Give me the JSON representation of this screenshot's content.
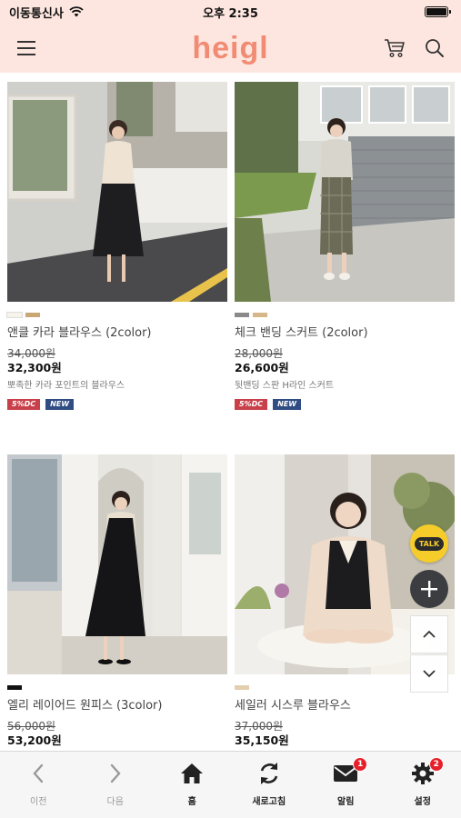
{
  "status_bar": {
    "carrier": "이동통신사",
    "time": "오후 2:35",
    "battery_level": 1.0
  },
  "header": {
    "logo": "heigl"
  },
  "products": [
    {
      "name": "앤클 카라 블라우스 (2color)",
      "original_price": "34,000원",
      "price": "32,300원",
      "description": "뽀족한 카라 포인트의 블라우스",
      "swatches": [
        "#f7f3ea",
        "#c8a774"
      ],
      "badges": [
        "5%DC",
        "NEW"
      ]
    },
    {
      "name": "체크 밴딩 스커트 (2color)",
      "original_price": "28,000원",
      "price": "26,600원",
      "description": "뒷밴딩 스판 H라인 스커트",
      "swatches": [
        "#8a8a8a",
        "#d6b78a"
      ],
      "badges": [
        "5%DC",
        "NEW"
      ]
    },
    {
      "name": "엘리 레이어드 원피스 (3color)",
      "original_price": "56,000원",
      "price": "53,200원",
      "swatches": [
        "#111111"
      ]
    },
    {
      "name": "세일러 시스루 블라우스",
      "original_price": "37,000원",
      "price": "35,150원",
      "swatches": [
        "#e3cfae"
      ]
    }
  ],
  "floating": {
    "talk_label": "TALK"
  },
  "bottom_nav": [
    {
      "label": "이전",
      "icon": "chevron-left-icon"
    },
    {
      "label": "다음",
      "icon": "chevron-right-icon"
    },
    {
      "label": "홈",
      "icon": "home-icon"
    },
    {
      "label": "새로고침",
      "icon": "refresh-icon"
    },
    {
      "label": "알림",
      "icon": "mail-icon",
      "badge": "1"
    },
    {
      "label": "설정",
      "icon": "gear-icon",
      "badge": "2"
    }
  ],
  "colors": {
    "header_bg": "#fde6df",
    "logo": "#f28b73",
    "discount_badge": "#c9404b",
    "new_badge": "#2f4c83",
    "notification": "#e5202a",
    "talk": "#f5cc2a"
  }
}
